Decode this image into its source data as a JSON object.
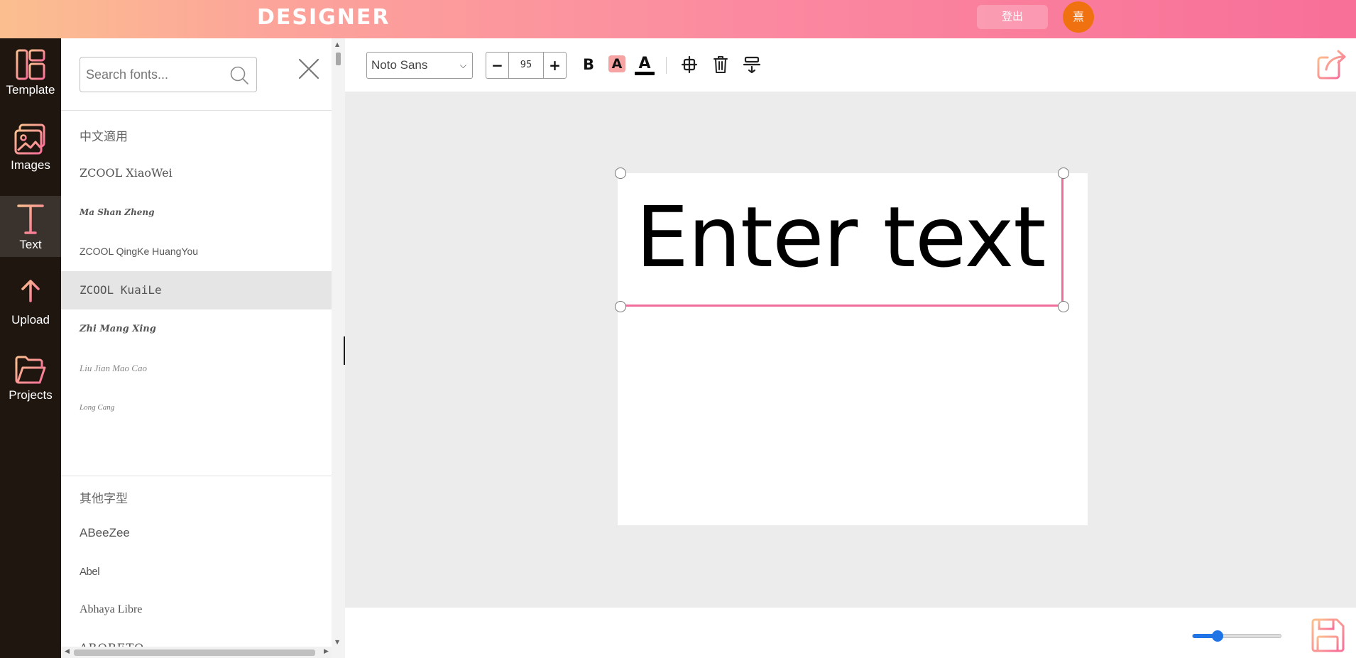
{
  "header": {
    "logo": "DESIGNER",
    "logout_label": "登出",
    "avatar_text": "熹"
  },
  "sidebar": {
    "items": [
      {
        "label": "Template",
        "icon": "template-icon",
        "active": false
      },
      {
        "label": "Images",
        "icon": "images-icon",
        "active": false
      },
      {
        "label": "Text",
        "icon": "text-icon",
        "active": true
      },
      {
        "label": "Upload",
        "icon": "upload-icon",
        "active": false
      },
      {
        "label": "Projects",
        "icon": "folder-icon",
        "active": false
      }
    ]
  },
  "font_panel": {
    "search_placeholder": "Search fonts...",
    "sections": [
      {
        "title": "中文適用",
        "fonts": [
          "ZCOOL XiaoWei",
          "Ma Shan Zheng",
          "ZCOOL QingKe HuangYou",
          "ZCOOL KuaiLe",
          "Zhi Mang Xing",
          "Liu Jian Mao Cao",
          "Long Cang"
        ]
      },
      {
        "title": "其他字型",
        "fonts": [
          "ABeeZee",
          "Abel",
          "Abhaya Libre",
          "ABORETO"
        ]
      }
    ],
    "hovered_font": "ZCOOL KuaiLe"
  },
  "toolbar": {
    "font_family": "Noto Sans",
    "font_size": "95",
    "minus_label": "−",
    "plus_label": "+",
    "bold_label": "B",
    "highlight_label": "A",
    "color_label": "A",
    "color_bar": "#000000",
    "highlight_bg": "#f5a3a3"
  },
  "canvas": {
    "text_content": "Enter text",
    "selection_color": "#f06d9b"
  },
  "zoom": {
    "level": 0.28,
    "accent": "#1f74e6"
  },
  "colors": {
    "sidebar_bg": "#1f1610",
    "icon_accent": "#f58a8a",
    "avatar_bg": "#f0710f"
  }
}
